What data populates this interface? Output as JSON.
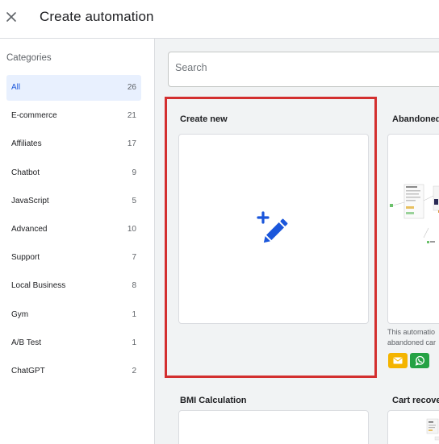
{
  "header": {
    "title": "Create automation"
  },
  "sidebar": {
    "heading": "Categories",
    "items": [
      {
        "label": "All",
        "count": "26"
      },
      {
        "label": "E-commerce",
        "count": "21"
      },
      {
        "label": "Affiliates",
        "count": "17"
      },
      {
        "label": "Chatbot",
        "count": "9"
      },
      {
        "label": "JavaScript",
        "count": "5"
      },
      {
        "label": "Advanced",
        "count": "10"
      },
      {
        "label": "Support",
        "count": "7"
      },
      {
        "label": "Local Business",
        "count": "8"
      },
      {
        "label": "Gym",
        "count": "1"
      },
      {
        "label": "A/B Test",
        "count": "1"
      },
      {
        "label": "ChatGPT",
        "count": "2"
      }
    ]
  },
  "search": {
    "placeholder": "Search",
    "value": ""
  },
  "cards": {
    "create_new": {
      "title": "Create new",
      "icon": "edit-sparkle-icon"
    },
    "abandoned": {
      "title": "Abandoned",
      "desc_line1": "This automatio",
      "desc_line2": "abandoned car"
    },
    "bmi": {
      "title": "BMI Calculation"
    },
    "cart": {
      "title": "Cart recove"
    }
  },
  "colors": {
    "accent": "#1a56db",
    "selection": "#d32f2f",
    "email": "#f4b400",
    "whatsapp": "#25a244"
  }
}
